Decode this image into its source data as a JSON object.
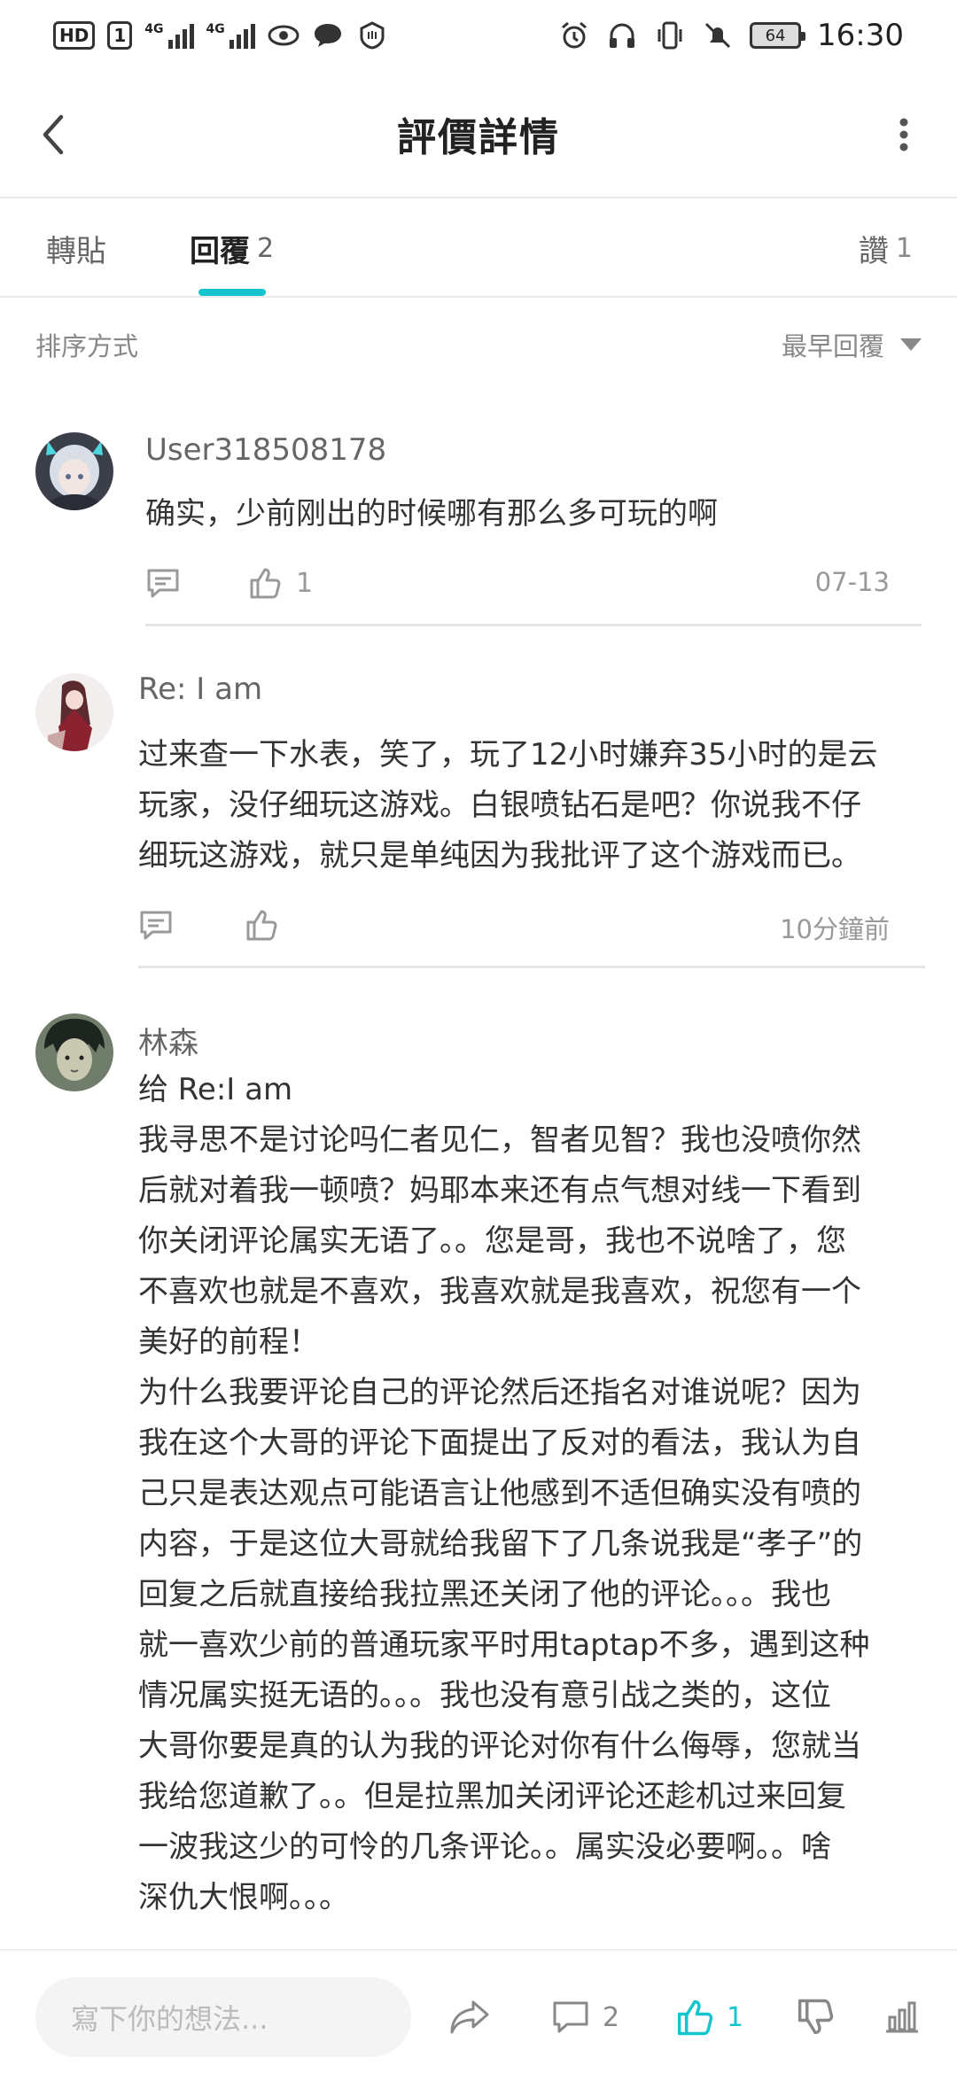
{
  "status_bar": {
    "left_chips": [
      "HD",
      "1"
    ],
    "signal_1": "4G",
    "signal_2": "4G",
    "battery_level": "64",
    "time": "16:30"
  },
  "header": {
    "title": "評價詳情"
  },
  "tabs": [
    {
      "label": "轉貼",
      "count": ""
    },
    {
      "label": "回覆",
      "count": "2"
    },
    {
      "label": "讚",
      "count": "1"
    }
  ],
  "sort": {
    "label": "排序方式",
    "selected": "最早回覆"
  },
  "comments": [
    {
      "username": "User318508178",
      "text": "确实，少前刚出的时候哪有那么多可玩的啊",
      "likes": "1",
      "date": "07-13"
    },
    {
      "username": "Re: I am",
      "text": "过来查一下水表，笑了，玩了12小时嫌弃35小时的是云\n玩家，没仔细玩这游戏。白银喷钻石是吧？你说我不仔\n细玩这游戏，就只是单纯因为我批评了这个游戏而已。",
      "likes": "",
      "date": "10分鐘前"
    },
    {
      "username": "林森",
      "text": "给 Re:I am\n我寻思不是讨论吗仁者见仁，智者见智？我也没喷你然\n后就对着我一顿喷？妈耶本来还有点气想对线一下看到\n你关闭评论属实无语了。。您是哥，我也不说啥了，您\n不喜欢也就是不喜欢，我喜欢就是我喜欢，祝您有一个\n美好的前程！\n为什么我要评论自己的评论然后还指名对谁说呢？因为\n我在这个大哥的评论下面提出了反对的看法，我认为自\n己只是表达观点可能语言让他感到不适但确实没有喷的\n内容，于是这位大哥就给我留下了几条说我是“孝子”的\n回复之后就直接给我拉黑还关闭了他的评论。。。我也\n就一喜欢少前的普通玩家平时用taptap不多，遇到这种\n情况属实挺无语的。。。我也没有意引战之类的，这位\n大哥你要是真的认为我的评论对你有什么侮辱，您就当\n我给您道歉了。。但是拉黑加关闭评论还趁机过来回复\n一波我这少的可怜的几条评论。。属实没必要啊。。啥\n深仇大恨啊。。。"
    }
  ],
  "bottom_bar": {
    "input_placeholder": "寫下你的想法...",
    "comment_count": "2",
    "like_count": "1"
  },
  "colors": {
    "accent": "#15c5ce",
    "muted": "#999999"
  }
}
